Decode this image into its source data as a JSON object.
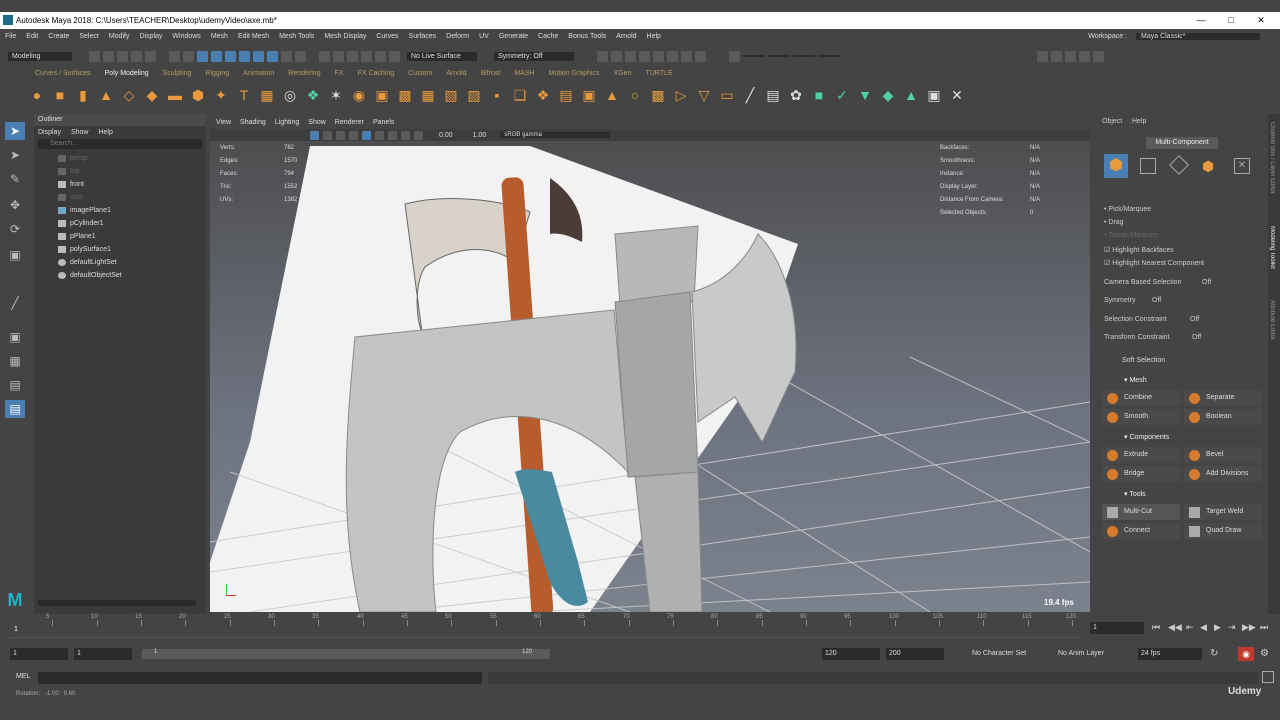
{
  "app": {
    "title": "Autodesk Maya 2018: C:\\Users\\TEACHER\\Desktop\\udemyVideo\\axe.mb*"
  },
  "menubar": {
    "items": [
      "File",
      "Edit",
      "Create",
      "Select",
      "Modify",
      "Display",
      "Windows",
      "Mesh",
      "Edit Mesh",
      "Mesh Tools",
      "Mesh Display",
      "Curves",
      "Surfaces",
      "Deform",
      "UV",
      "Generate",
      "Cache",
      "Bonus Tools",
      "Arnold",
      "Help"
    ],
    "workspace_label": "Workspace :",
    "workspace_value": "Maya Classic*"
  },
  "statusline": {
    "menuset": "Modeling",
    "live_surface": "No Live Surface",
    "symmetry": "Symmetry: Off"
  },
  "shelf": {
    "tabs": [
      "Curves / Surfaces",
      "Poly Modeling",
      "Sculpting",
      "Rigging",
      "Animation",
      "Rendering",
      "FX",
      "FX Caching",
      "Custom",
      "Arnold",
      "Bifrost",
      "MASH",
      "Motion Graphics",
      "XGen",
      "TURTLE"
    ],
    "active_tab": "Poly Modeling"
  },
  "outliner": {
    "title": "Outliner",
    "menus": [
      "Display",
      "Show",
      "Help"
    ],
    "search_placeholder": "Search...",
    "items": [
      {
        "label": "persp",
        "dim": true
      },
      {
        "label": "top",
        "dim": true
      },
      {
        "label": "front",
        "dim": false
      },
      {
        "label": "side",
        "dim": true
      },
      {
        "label": "imagePlane1",
        "dim": false
      },
      {
        "label": "pCylinder1",
        "dim": false
      },
      {
        "label": "pPlane1",
        "dim": false
      },
      {
        "label": "polySurface1",
        "dim": false
      },
      {
        "label": "defaultLightSet",
        "dim": false
      },
      {
        "label": "defaultObjectSet",
        "dim": false
      }
    ]
  },
  "viewport": {
    "menus": [
      "View",
      "Shading",
      "Lighting",
      "Show",
      "Renderer",
      "Panels"
    ],
    "exposure": "0.00",
    "gamma": "1.00",
    "color_space": "sRGB gamma",
    "hud_left": [
      {
        "label": "Verts:",
        "value": "782"
      },
      {
        "label": "Edges:",
        "value": "1570"
      },
      {
        "label": "Faces:",
        "value": "794"
      },
      {
        "label": "Tris:",
        "value": "1552"
      },
      {
        "label": "UVs:",
        "value": "1382"
      }
    ],
    "hud_right": [
      {
        "label": "Backfaces:",
        "value": "N/A"
      },
      {
        "label": "Smoothness:",
        "value": "N/A"
      },
      {
        "label": "Instance:",
        "value": "N/A"
      },
      {
        "label": "Display Layer:",
        "value": "N/A"
      },
      {
        "label": "Distance From Camera:",
        "value": "N/A"
      },
      {
        "label": "Selected Objects:",
        "value": "0"
      }
    ],
    "fps": "19.4 fps"
  },
  "modeling_toolkit": {
    "menus": [
      "Object",
      "Help"
    ],
    "mode": "Multi-Component",
    "options": [
      {
        "label": "Pick/Marquee",
        "checked": false
      },
      {
        "label": "Drag",
        "checked": false
      },
      {
        "label": "Tweak/Marquee",
        "checked": false
      },
      {
        "label": "Highlight Backfaces",
        "checked": true
      },
      {
        "label": "Highlight Nearest Component",
        "checked": true
      }
    ],
    "camera_based_selection": {
      "label": "Camera Based Selection",
      "value": "Off"
    },
    "symmetry": {
      "label": "Symmetry",
      "value": "Off"
    },
    "selection_constraint": {
      "label": "Selection Constraint",
      "value": "Off"
    },
    "transform_constraint": {
      "label": "Transform Constraint",
      "value": "Off"
    },
    "soft_selection": "Soft Selection",
    "sections": {
      "mesh": {
        "title": "Mesh",
        "buttons": [
          "Combine",
          "Separate",
          "Smooth",
          "Boolean"
        ]
      },
      "components": {
        "title": "Components",
        "buttons": [
          "Extrude",
          "Bevel",
          "Bridge",
          "Add Divisions"
        ]
      },
      "tools": {
        "title": "Tools",
        "buttons": [
          "Multi-Cut",
          "Target Weld",
          "Connect",
          "Quad Draw"
        ]
      }
    },
    "side_tabs": [
      "Channel Box / Layer Editor",
      "Modeling Toolkit",
      "Attribute Editor"
    ]
  },
  "timeline": {
    "ticks": [
      "5",
      "10",
      "15",
      "20",
      "25",
      "30",
      "35",
      "40",
      "45",
      "50",
      "55",
      "60",
      "65",
      "70",
      "75",
      "80",
      "85",
      "90",
      "95",
      "100",
      "105",
      "110",
      "115",
      "120"
    ],
    "current_frame": "1",
    "current_frame_field": "1"
  },
  "range": {
    "start": "1",
    "playback_start": "1",
    "range_start_label": "1",
    "range_end_label": "120",
    "playback_end": "120",
    "end": "200",
    "character_set": "No Character Set",
    "anim_layer": "No Anim Layer",
    "fps": "24 fps"
  },
  "command": {
    "mel_label": "MEL"
  },
  "helpline": {
    "text": "Rotation:   -1.00   0.60"
  },
  "branding": {
    "watermark": "Udemy"
  },
  "colors": {
    "accent_orange": "#e89a3c",
    "accent_blue": "#4a7fb3",
    "ui_bg": "#444444"
  }
}
